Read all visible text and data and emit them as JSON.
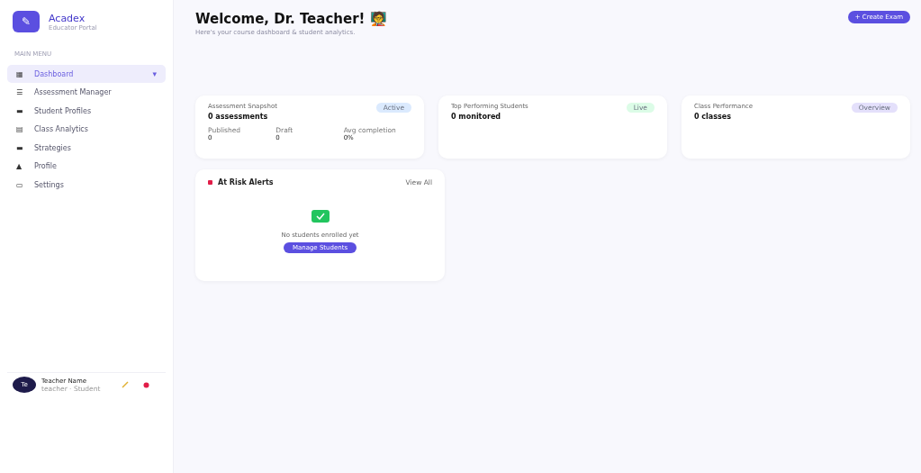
{
  "brand": {
    "name": "Acadex",
    "tagline": "Educator Portal",
    "logo": "✎"
  },
  "sidebar": {
    "section": "MAIN MENU",
    "items": [
      {
        "label": "Dashboard",
        "icon": "▦",
        "selected": true,
        "caret": "▾"
      },
      {
        "label": "Assessment Manager",
        "icon": "☰",
        "selected": false
      },
      {
        "label": "Student Profiles",
        "icon": "▬",
        "selected": false
      },
      {
        "label": "Class Analytics",
        "icon": "▤",
        "selected": false
      },
      {
        "label": "Strategies",
        "icon": "▬",
        "selected": false
      },
      {
        "label": "Profile",
        "icon": "▲",
        "selected": false
      },
      {
        "label": "Settings",
        "icon": "▭",
        "selected": false
      }
    ]
  },
  "user": {
    "initials": "Te",
    "name": "Teacher Name",
    "role": "teacher · Student"
  },
  "header": {
    "title": "Welcome, Dr. Teacher!",
    "emoji": "🧑‍🏫",
    "subtitle": "Here's your course dashboard & student analytics.",
    "action": "+ Create Exam"
  },
  "cards": [
    {
      "title": "Assessment Snapshot",
      "badge": "Active",
      "color": "#dbeafe",
      "value": "0 assessments",
      "stats": [
        {
          "label": "Published",
          "value": "0"
        },
        {
          "label": "Draft",
          "value": "0"
        },
        {
          "label": "Avg completion",
          "value": "0%"
        }
      ]
    },
    {
      "title": "Top Performing Students",
      "badge": "Live",
      "color": "#dcfce7",
      "value": "0 monitored"
    },
    {
      "title": "Class Performance",
      "badge": "Overview",
      "color": "#e4e0fb",
      "value": "0 classes"
    }
  ],
  "alerts": {
    "title": "At Risk Alerts",
    "link": "View All",
    "empty": "No students enrolled yet",
    "button": "Manage Students"
  }
}
